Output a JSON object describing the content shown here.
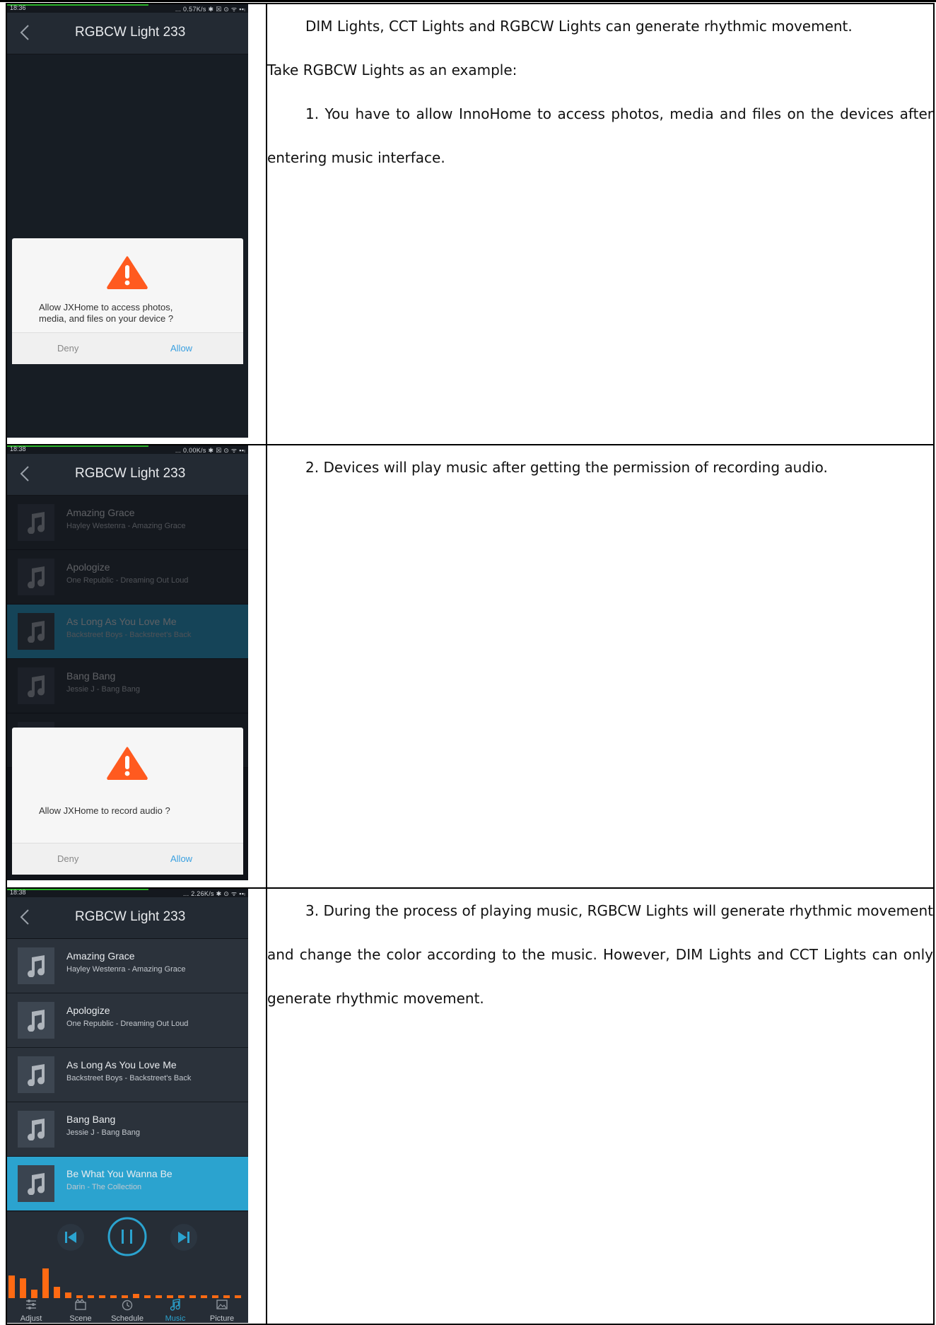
{
  "rows": [
    {
      "screen": {
        "time": "18:36",
        "net": "... 0.57K/s ✱ ☒ ⊙ ᯤ ▪▪ₗ",
        "title": "RGBCW Light 233",
        "dialog": {
          "message": "Allow JXHome to access photos, media, and files on your device ?",
          "deny": "Deny",
          "allow": "Allow"
        }
      },
      "paragraphs": [
        "DIM Lights, CCT Lights and RGBCW Lights can generate rhythmic movement.",
        "Take RGBCW Lights as an example:",
        "1. You have to allow InnoHome to access photos, media and files on the devices after entering music interface."
      ]
    },
    {
      "screen": {
        "time": "18:38",
        "net": "... 0.00K/s ✱ ☒ ⊙ ᯤ ▪▪ₗ",
        "title": "RGBCW Light 233",
        "dialog": {
          "message": "Allow JXHome to record audio ?",
          "deny": "Deny",
          "allow": "Allow"
        }
      },
      "paragraphs": [
        "2. Devices will play music after getting the permission of recording audio."
      ]
    },
    {
      "screen": {
        "time": "18:38",
        "net": "... 2.26K/s ✱ ⊙ ᯤ ▪▪ₗ",
        "title": "RGBCW Light 233",
        "tabs": [
          "Adjust",
          "Scene",
          "Schedule",
          "Music",
          "Picture"
        ],
        "active_tab": "Music",
        "active_song": "Be What You Wanna Be"
      },
      "paragraphs": [
        "3. During the process of playing music, RGBCW Lights will generate rhythmic movement and change the color according to the music. However, DIM Lights and CCT Lights can only generate rhythmic movement."
      ]
    }
  ],
  "songs": [
    {
      "name": "Amazing Grace",
      "artist": "Hayley Westenra - Amazing Grace"
    },
    {
      "name": "Apologize",
      "artist": "One Republic - Dreaming Out Loud"
    },
    {
      "name": "As Long As You Love Me",
      "artist": "Backstreet Boys - Backstreet's Back"
    },
    {
      "name": "Bang Bang",
      "artist": "Jessie J - Bang Bang"
    },
    {
      "name": "Be What You Wanna Be",
      "artist": "Darin - The Collection"
    }
  ],
  "colors": {
    "accent": "#2ba3cf",
    "warning": "#ff5a1f",
    "equalizer": "#ff6a13"
  },
  "icons": [
    "back-arrow-icon",
    "music-note-icon",
    "warning-icon",
    "previous-icon",
    "pause-icon",
    "next-icon",
    "adjust-icon",
    "scene-icon",
    "schedule-icon",
    "music-icon",
    "picture-icon"
  ]
}
